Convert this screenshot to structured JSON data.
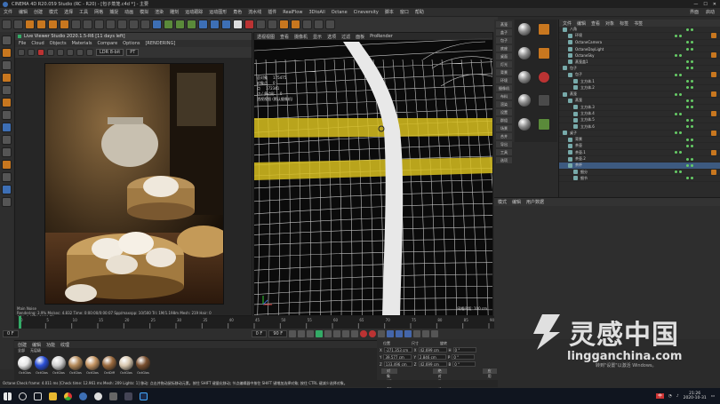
{
  "window": {
    "title": "CINEMA 4D R20.059 Studio (RC - R20) - [包子蒸笼.c4d *] - 主要",
    "controls": [
      "—",
      "☐",
      "✕"
    ]
  },
  "menubar": {
    "items": [
      "文件",
      "编辑",
      "创建",
      "模式",
      "选择",
      "工具",
      "网格",
      "捕捉",
      "动画",
      "模拟",
      "渲染",
      "雕刻",
      "运动跟踪",
      "运动图形",
      "角色",
      "流水线",
      "插件",
      "RealFlow",
      "3DtoAll",
      "Octane",
      "Cineversity",
      "脚本",
      "窗口",
      "帮助"
    ],
    "right": [
      "界面",
      "启动"
    ]
  },
  "live_viewer": {
    "title": "Live Viewer Studio 2020.1.5-R6 [11 days left]",
    "menu": [
      "File",
      "Cloud",
      "Objects",
      "Materials",
      "Compare",
      "Options",
      "[RENDERING]"
    ],
    "mode_select": "LDR 8-bit",
    "pt_select": "PT",
    "status_lines": [
      "Main  Noise",
      "Rendering: 3.9%  Ms/sec: 4.832  Time: 0:00:00/0:00:07  Spp/maxspp: 10/500  Tri: 1M/1.198m  Mesh: 219  Hair: 0",
      "GPU: 1 [RTX 2080 Ti]"
    ]
  },
  "viewport": {
    "menu": [
      "透视视图",
      "查看",
      "摄像机",
      "显示",
      "选项",
      "过滤",
      "面板",
      "ProRender"
    ],
    "info": [
      {
        "label": "总对象",
        "value": "175475"
      },
      {
        "label": "对象点",
        "value": "0"
      },
      {
        "label": "点",
        "value": "172341"
      },
      {
        "label": "边 / 多边形",
        "value": "0"
      }
    ],
    "info_tail": "透视视图 (默认摄像机)",
    "grid_label": "网格间距: 100 cm"
  },
  "attr_column": [
    "蒸笼",
    "盖子",
    "包子",
    "底座",
    "桌面",
    "灯光",
    "背景",
    "环境",
    "摄像机",
    "布料",
    "渲染",
    "设置",
    "群组",
    "场景",
    "合并",
    "导出",
    "工具",
    "选项"
  ],
  "object_manager": {
    "header": [
      "文件",
      "编辑",
      "查看",
      "对象",
      "标签",
      "书签"
    ],
    "rows": [
      {
        "name": "八角",
        "indent": 0,
        "sel": false
      },
      {
        "name": "环境",
        "indent": 1,
        "sel": false
      },
      {
        "name": "OctaneCamera",
        "indent": 1,
        "sel": false
      },
      {
        "name": "OctaneDayLight",
        "indent": 1,
        "sel": false
      },
      {
        "name": "OctaneSky",
        "indent": 1,
        "sel": false
      },
      {
        "name": "蒸笼盖1",
        "indent": 1,
        "sel": false
      },
      {
        "name": "包子",
        "indent": 0,
        "sel": false
      },
      {
        "name": "包子",
        "indent": 1,
        "sel": false
      },
      {
        "name": "立方体.1",
        "indent": 2,
        "sel": false
      },
      {
        "name": "立方体.2",
        "indent": 2,
        "sel": false
      },
      {
        "name": "蒸笼",
        "indent": 0,
        "sel": false
      },
      {
        "name": "蒸笼",
        "indent": 1,
        "sel": false
      },
      {
        "name": "立方体.3",
        "indent": 2,
        "sel": false
      },
      {
        "name": "立方体.4",
        "indent": 2,
        "sel": false
      },
      {
        "name": "立方体.5",
        "indent": 2,
        "sel": false
      },
      {
        "name": "立方体.6",
        "indent": 2,
        "sel": false
      },
      {
        "name": "桌子",
        "indent": 0,
        "sel": false
      },
      {
        "name": "背景",
        "indent": 1,
        "sel": false
      },
      {
        "name": "茶壶",
        "indent": 1,
        "sel": false
      },
      {
        "name": "茶壶.1",
        "indent": 1,
        "sel": false
      },
      {
        "name": "茶壶.2",
        "indent": 1,
        "sel": false
      },
      {
        "name": "茶杯",
        "indent": 1,
        "sel": true
      },
      {
        "name": "细分",
        "indent": 2,
        "sel": false
      },
      {
        "name": "细节",
        "indent": 2,
        "sel": false
      }
    ]
  },
  "attribute_manager": {
    "header": [
      "模式",
      "编辑",
      "用户数据"
    ]
  },
  "timeline": {
    "ticks": [
      "0",
      "5",
      "10",
      "15",
      "20",
      "25",
      "30",
      "35",
      "40",
      "45",
      "50",
      "55",
      "60",
      "65",
      "70",
      "75",
      "80",
      "85",
      "90"
    ],
    "current": "0 F",
    "start": "0 F",
    "end": "90 F",
    "playhead_frac": 0
  },
  "material_manager": {
    "header": [
      "创建",
      "编辑",
      "功能",
      "纹理"
    ],
    "filter": [
      "全部",
      "无层级"
    ],
    "materials": [
      {
        "label": "OctGlos",
        "color": "#e8e8e8"
      },
      {
        "label": "OctGlos",
        "color": "#2a4fd6"
      },
      {
        "label": "OctGlos",
        "color": "#d0d0d0"
      },
      {
        "label": "OctGlos",
        "color": "#b48a5a"
      },
      {
        "label": "OctGlos",
        "color": "#c49462"
      },
      {
        "label": "OctDiff",
        "color": "#9a6a3e"
      },
      {
        "label": "OctGlos",
        "color": "#d8c8b0"
      },
      {
        "label": "OctGlos",
        "color": "#7a5030"
      }
    ]
  },
  "coordinates": {
    "headers": [
      "位置",
      "尺寸",
      "旋转"
    ],
    "rows": [
      {
        "axis": "X",
        "pos": "-271.353 cm",
        "size": "42.699 cm",
        "rot_label": "H",
        "rot": "0 °"
      },
      {
        "axis": "Y",
        "pos": "39.577 cm",
        "size": "2.846 cm",
        "rot_label": "P",
        "rot": "0 °"
      },
      {
        "axis": "Z",
        "pos": "133.496 cm",
        "size": "42.699 cm",
        "rot_label": "B",
        "rot": "0 °"
      }
    ],
    "mode_select": "对象 (相对)",
    "size_select": "绝对尺寸",
    "apply": "应用"
  },
  "statusbar": {
    "text": "Octane:Check frame: 4.011 ms  [Check time: 12.961 ms  Mesh: 209  Lights: 1]  移动: 点击并拖动鼠标移动元素。按住 SHIFT 键量化移动; 节点编辑器中按住 SHIFT 键增加选择对象; 按住 CTRL 键减少选择对象。"
  },
  "watermark": {
    "cn": "灵感中国",
    "url": "lingganchina.com",
    "activate": "转到\"设置\"以激活 Windows。"
  },
  "taskbar": {
    "time": "21:26",
    "date": "2020-10-31",
    "ime": "中",
    "icons": [
      "windows-icon",
      "search-icon",
      "task-view-icon",
      "explorer-icon",
      "chrome-icon",
      "c4d-icon",
      "app-icon",
      "app-icon",
      "app-icon",
      "ps-icon"
    ]
  }
}
